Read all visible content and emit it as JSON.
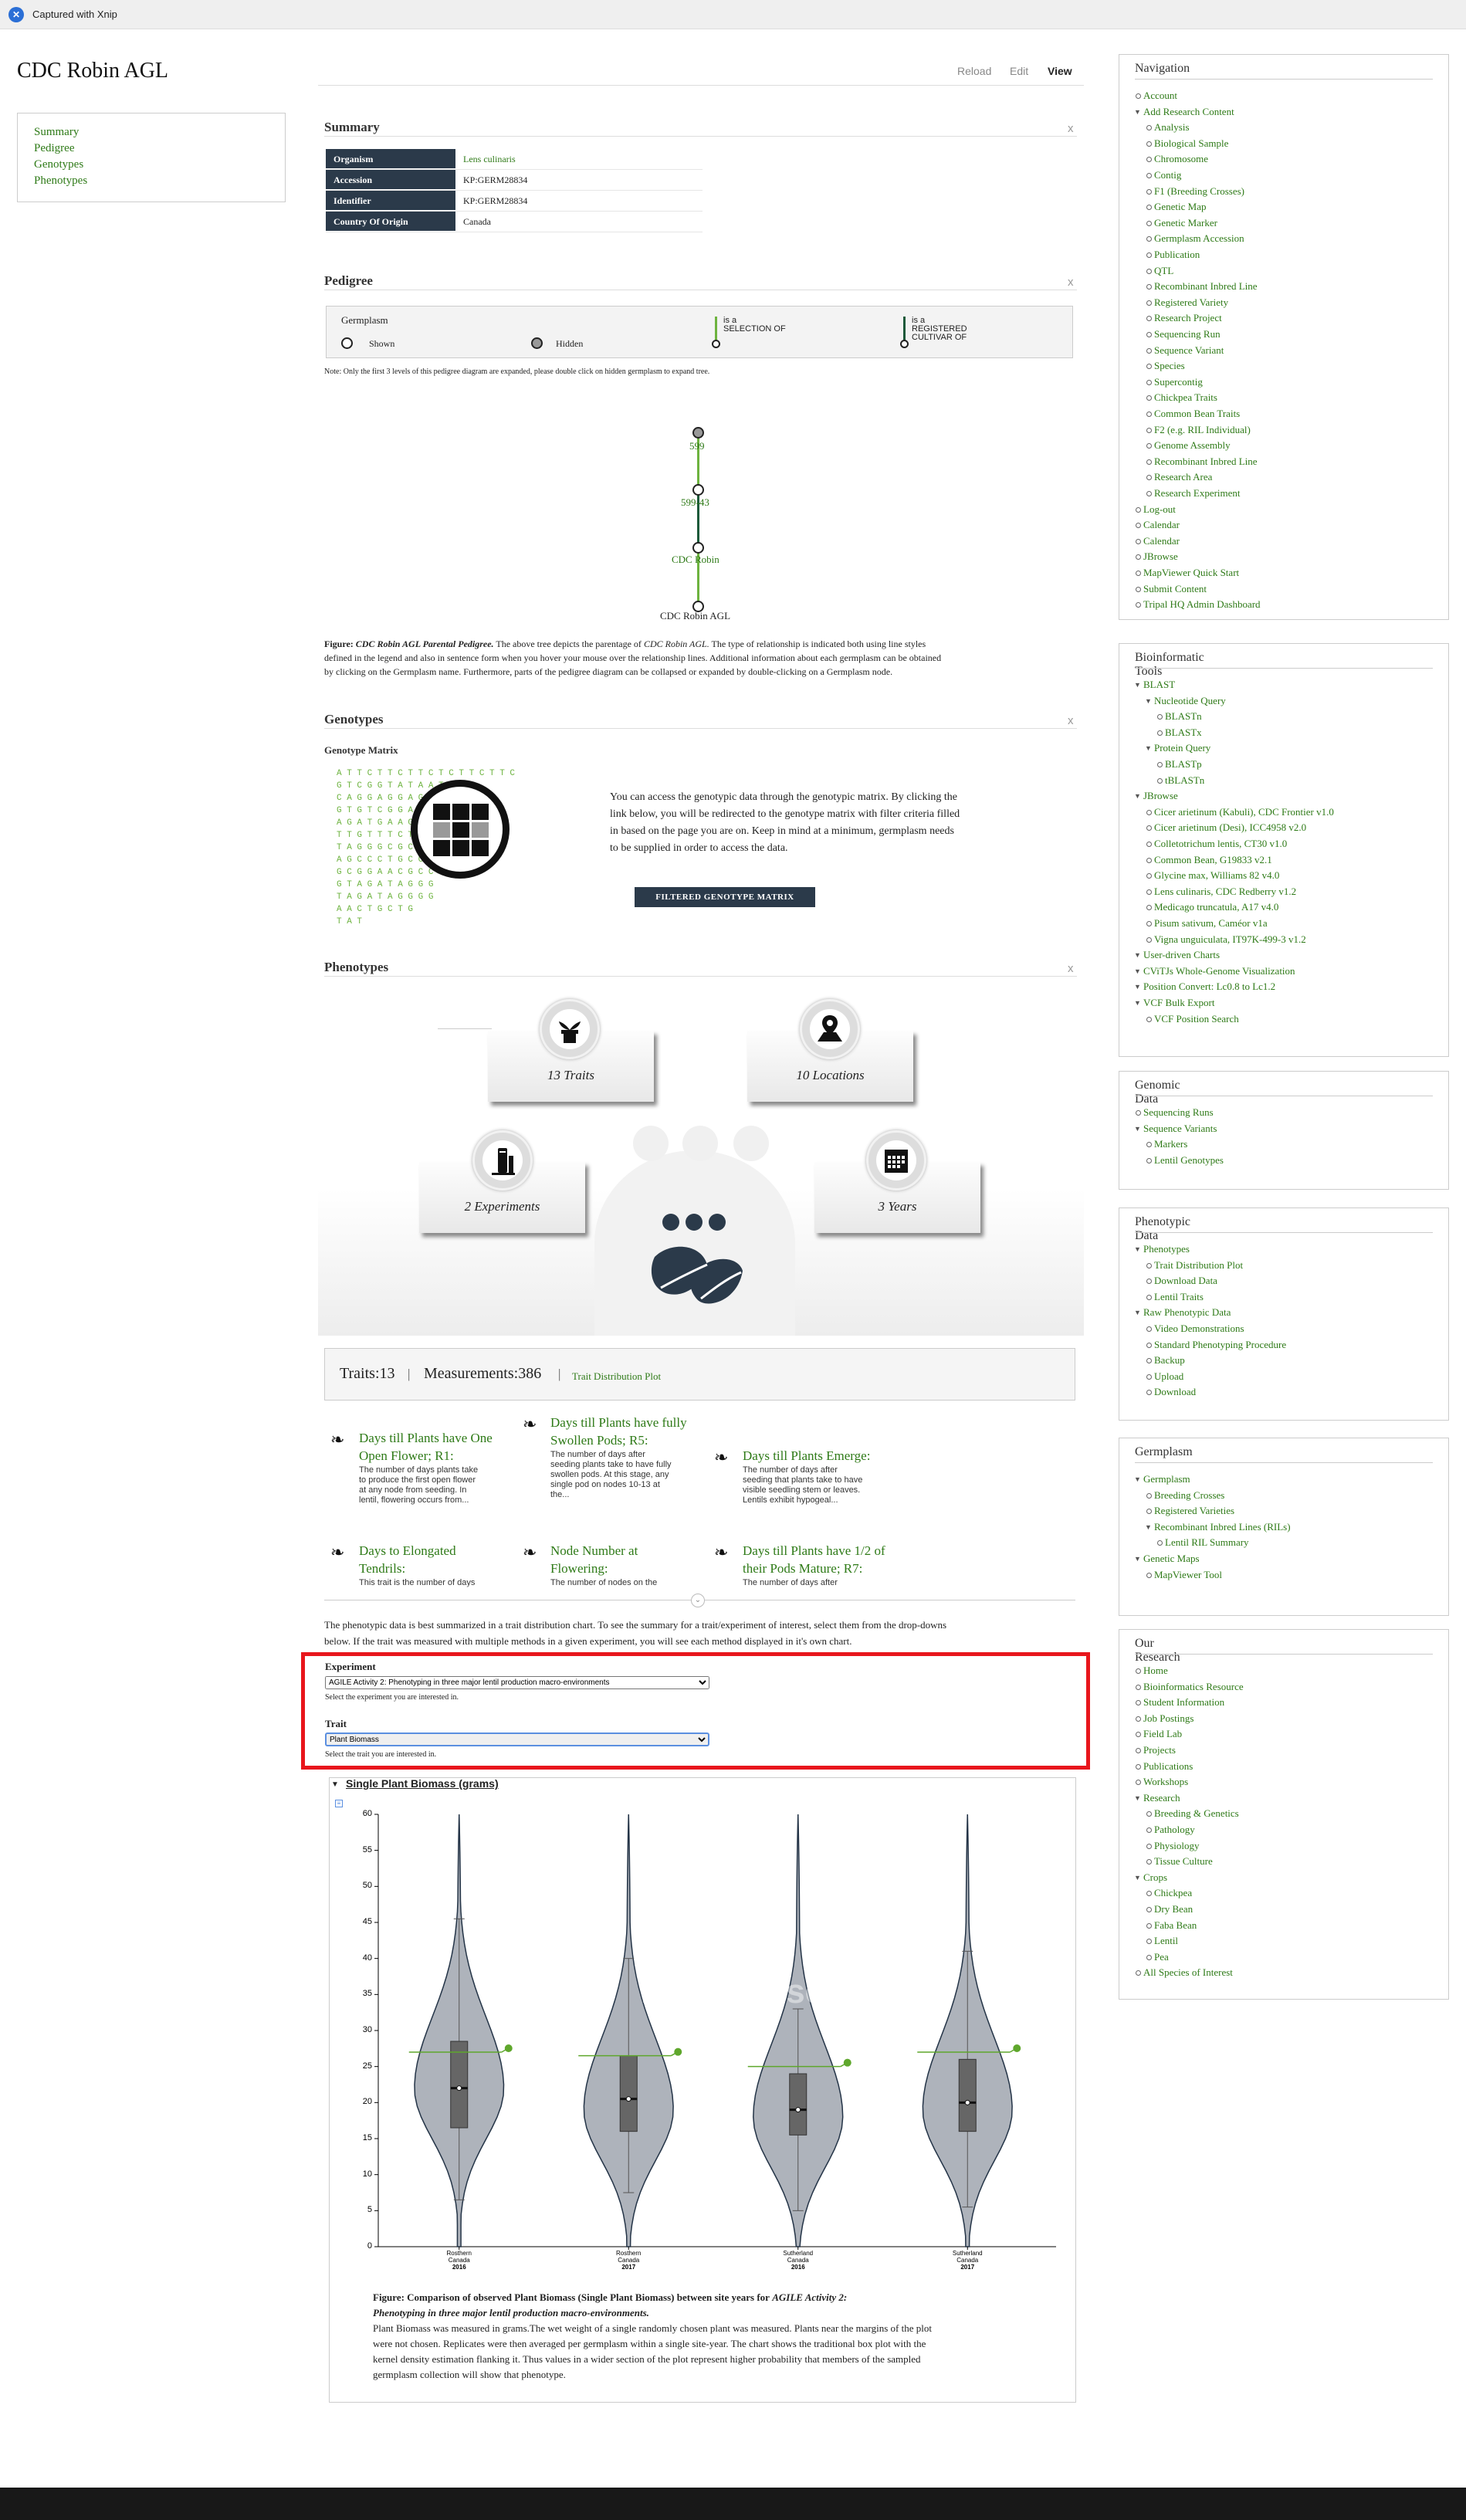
{
  "xnip": {
    "text": "Captured with Xnip"
  },
  "page": {
    "title": "CDC Robin AGL",
    "tabs": [
      "Reload",
      "Edit",
      "View"
    ]
  },
  "left_nav": [
    "Summary",
    "Pedigree",
    "Genotypes",
    "Phenotypes"
  ],
  "summary": {
    "heading": "Summary",
    "close": "x",
    "rows": [
      {
        "label": "Organism",
        "value": "Lens culinaris"
      },
      {
        "label": "Accession",
        "value": "KP:GERM28834"
      },
      {
        "label": "Identifier",
        "value": "KP:GERM28834"
      },
      {
        "label": "Country Of Origin",
        "value": "Canada"
      }
    ]
  },
  "pedigree": {
    "heading": "Pedigree",
    "close": "x",
    "legend": {
      "title": "Germplasm",
      "shown": "Shown",
      "hidden": "Hidden",
      "sel1": "is a",
      "sel2": "SELECTION OF",
      "reg1": "is a",
      "reg2": "REGISTERED",
      "reg3": "CULTIVAR OF"
    },
    "note": "Note: Only the first 3 levels of this pedigree diagram are expanded, please double click on hidden germplasm to expand tree.",
    "nodes": [
      "599",
      "599-43",
      "CDC Robin",
      "CDC Robin AGL"
    ],
    "fig_label": "Figure:",
    "fig_bold": "CDC Robin AGL Parental Pedigree.",
    "fig_text1": "The above tree depicts the parentage of",
    "fig_em": "CDC Robin AGL.",
    "fig_text2": "The type of relationship is indicated both using line styles",
    "fig_line2": "defined in the legend and also in sentence form when you hover your mouse over the relationship lines. Additional information about each germplasm can be obtained",
    "fig_line3": "by clicking on the Germplasm name. Furthermore, parts of the pedigree diagram can be collapsed or expanded by double-clicking on a Germplasm node."
  },
  "genotypes": {
    "heading": "Genotypes",
    "close": "x",
    "matrix_title": "Genotype Matrix",
    "dna_rows": [
      "A T T C T T C T T C T C T T C T T C",
      "G T C G G T A T A A T A",
      "C A G G A G G A G G A G",
      "G T G T C G G A G A T G",
      "A G A T G A A G T G G A",
      "T T G T T T C T T G T T",
      "T A G G G C G C C A",
      "A G C C C T G C C C",
      "G C G G A A C G C C",
      "G T A G A T A G G G",
      "T A G A T A G G G G",
      "A A C T G C T G",
      "T A T"
    ],
    "text": [
      "You can access the genotypic data through the genotypic matrix. By clicking the",
      "link below, you will be redirected to the genotype matrix with filter criteria filled",
      "in based on the page you are on. Keep in mind at a minimum, germplasm needs",
      "to be supplied in order to access the data."
    ],
    "button": "FILTERED GENOTYPE MATRIX"
  },
  "phenotypes": {
    "heading": "Phenotypes",
    "close": "x",
    "cards": [
      "13 Traits",
      "10 Locations",
      "2 Experiments",
      "3 Years"
    ],
    "bar": {
      "traits": "Traits:13",
      "sep": "|",
      "measurements": "Measurements:386",
      "link": "Trait Distribution Plot"
    },
    "traits": [
      {
        "title": [
          "Days till Plants have One",
          "Open Flower; R1:"
        ],
        "desc": [
          "The number of days plants take",
          "to produce the first open flower",
          "at any node from seeding. In",
          "lentil, flowering occurs from..."
        ]
      },
      {
        "title": [
          "Days till Plants have fully",
          "Swollen Pods; R5:"
        ],
        "desc": [
          "The number of days after",
          "seeding plants take to have fully",
          "swollen pods. At this stage, any",
          "single pod on nodes 10-13 at",
          "the..."
        ]
      },
      {
        "title": [
          "Days till Plants Emerge:"
        ],
        "desc": [
          "The number of days after",
          "seeding that plants take to have",
          "visible seedling stem or leaves.",
          "Lentils exhibit hypogeal..."
        ]
      },
      {
        "title": [
          "Days to Elongated",
          "Tendrils:"
        ],
        "desc": [
          "This trait is the number of days"
        ]
      },
      {
        "title": [
          "Node Number at",
          "Flowering:"
        ],
        "desc": [
          "The number of nodes on the"
        ]
      },
      {
        "title": [
          "Days till Plants have 1/2 of",
          "their Pods Mature; R7:"
        ],
        "desc": [
          "The number of days after"
        ]
      }
    ],
    "summary_text": [
      "The phenotypic data is best summarized in a trait distribution chart. To see the summary for a trait/experiment of interest, select them from the drop-downs",
      "below. If the trait was measured with multiple methods in a given experiment, you will see each method displayed in it's own chart."
    ],
    "form": {
      "exp_label": "Experiment",
      "exp_value": "AGILE Activity 2: Phenotyping in three major lentil production macro-environments",
      "exp_help": "Select the experiment you are interested in.",
      "trait_label": "Trait",
      "trait_value": "Plant Biomass",
      "trait_help": "Select the trait you are interested in."
    },
    "chart_title": "Single Plant Biomass (grams)",
    "watermark": "KnowPulse",
    "caption": {
      "lead": "Figure: Comparison of observed Plant Biomass (Single Plant Biomass) between site years for",
      "lead_em": "AGILE Activity 2:",
      "line2_em": "Phenotyping in three major lentil production macro-environments.",
      "body": [
        "Plant Biomass was measured in grams.The wet weight of a single randomly chosen plant was measured. Plants near the margins of the plot",
        "were not chosen. Replicates were then averaged per germplasm within a single site-year. The chart shows the traditional box plot with the",
        "kernel density estimation flanking it. Thus values in a wider section of the plot represent higher probability that members of the sampled",
        "germplasm collection will show that phenotype."
      ]
    }
  },
  "chart_data": {
    "type": "violin",
    "ylim": [
      0,
      60
    ],
    "yticks": [
      0,
      5,
      10,
      15,
      20,
      25,
      30,
      35,
      40,
      45,
      50,
      55,
      60
    ],
    "categories": [
      {
        "site": "Rosthern",
        "country": "Canada",
        "year": "2016"
      },
      {
        "site": "Rosthern",
        "country": "Canada",
        "year": "2017"
      },
      {
        "site": "Sutherland",
        "country": "Canada",
        "year": "2016"
      },
      {
        "site": "Sutherland",
        "country": "Canada",
        "year": "2017"
      }
    ],
    "series": [
      {
        "max": 60,
        "q1": 16.5,
        "median": 22,
        "q3": 28.5,
        "whisker_low": 6.5,
        "whisker_high": 45.5,
        "min": 0,
        "mode": 22,
        "highlight": 27
      },
      {
        "max": 60,
        "q1": 16,
        "median": 20.5,
        "q3": 26.5,
        "whisker_low": 7.5,
        "whisker_high": 40,
        "min": 0,
        "mode": 19,
        "highlight": 26.5
      },
      {
        "max": 60,
        "q1": 15.5,
        "median": 19,
        "q3": 24,
        "whisker_low": 5,
        "whisker_high": 33,
        "min": 0,
        "mode": 18,
        "highlight": 25
      },
      {
        "max": 60,
        "q1": 16,
        "median": 20,
        "q3": 26,
        "whisker_low": 5.5,
        "whisker_high": 41,
        "min": 0,
        "mode": 19,
        "highlight": 27
      }
    ]
  },
  "sidebar": {
    "navigation": {
      "heading": "Navigation",
      "items": [
        {
          "t": "Account",
          "l": 0,
          "m": "b"
        },
        {
          "t": "Add Research Content",
          "l": 0,
          "m": "t"
        },
        {
          "t": "Analysis",
          "l": 1,
          "m": "b"
        },
        {
          "t": "Biological Sample",
          "l": 1,
          "m": "b"
        },
        {
          "t": "Chromosome",
          "l": 1,
          "m": "b"
        },
        {
          "t": "Contig",
          "l": 1,
          "m": "b"
        },
        {
          "t": "F1 (Breeding Crosses)",
          "l": 1,
          "m": "b"
        },
        {
          "t": "Genetic Map",
          "l": 1,
          "m": "b"
        },
        {
          "t": "Genetic Marker",
          "l": 1,
          "m": "b"
        },
        {
          "t": "Germplasm Accession",
          "l": 1,
          "m": "b"
        },
        {
          "t": "Publication",
          "l": 1,
          "m": "b"
        },
        {
          "t": "QTL",
          "l": 1,
          "m": "b"
        },
        {
          "t": "Recombinant Inbred Line",
          "l": 1,
          "m": "b"
        },
        {
          "t": "Registered Variety",
          "l": 1,
          "m": "b"
        },
        {
          "t": "Research Project",
          "l": 1,
          "m": "b"
        },
        {
          "t": "Sequencing Run",
          "l": 1,
          "m": "b"
        },
        {
          "t": "Sequence Variant",
          "l": 1,
          "m": "b"
        },
        {
          "t": "Species",
          "l": 1,
          "m": "b"
        },
        {
          "t": "Supercontig",
          "l": 1,
          "m": "b"
        },
        {
          "t": "Chickpea Traits",
          "l": 1,
          "m": "b"
        },
        {
          "t": "Common Bean Traits",
          "l": 1,
          "m": "b"
        },
        {
          "t": "F2 (e.g. RIL Individual)",
          "l": 1,
          "m": "b"
        },
        {
          "t": "Genome Assembly",
          "l": 1,
          "m": "b"
        },
        {
          "t": "Recombinant Inbred Line",
          "l": 1,
          "m": "b"
        },
        {
          "t": "Research Area",
          "l": 1,
          "m": "b"
        },
        {
          "t": "Research Experiment",
          "l": 1,
          "m": "b"
        },
        {
          "t": "Log-out",
          "l": 0,
          "m": "b"
        },
        {
          "t": "Calendar",
          "l": 0,
          "m": "b"
        },
        {
          "t": "Calendar",
          "l": 0,
          "m": "b"
        },
        {
          "t": "JBrowse",
          "l": 0,
          "m": "b"
        },
        {
          "t": "MapViewer Quick Start",
          "l": 0,
          "m": "b"
        },
        {
          "t": "Submit Content",
          "l": 0,
          "m": "b"
        },
        {
          "t": "Tripal HQ Admin Dashboard",
          "l": 0,
          "m": "b"
        }
      ]
    },
    "bioinformatic": {
      "heading": "Bioinformatic Tools",
      "items": [
        {
          "t": "BLAST",
          "l": 0,
          "m": "t"
        },
        {
          "t": "Nucleotide Query",
          "l": 1,
          "m": "t"
        },
        {
          "t": "BLASTn",
          "l": 2,
          "m": "b"
        },
        {
          "t": "BLASTx",
          "l": 2,
          "m": "b"
        },
        {
          "t": "Protein Query",
          "l": 1,
          "m": "t"
        },
        {
          "t": "BLASTp",
          "l": 2,
          "m": "b"
        },
        {
          "t": "tBLASTn",
          "l": 2,
          "m": "b"
        },
        {
          "t": "JBrowse",
          "l": 0,
          "m": "t"
        },
        {
          "t": "Cicer arietinum (Kabuli), CDC Frontier v1.0",
          "l": 1,
          "m": "b"
        },
        {
          "t": "Cicer arietinum (Desi), ICC4958 v2.0",
          "l": 1,
          "m": "b"
        },
        {
          "t": "Colletotrichum lentis, CT30 v1.0",
          "l": 1,
          "m": "b"
        },
        {
          "t": "Common Bean, G19833 v2.1",
          "l": 1,
          "m": "b"
        },
        {
          "t": "Glycine max, Williams 82 v4.0",
          "l": 1,
          "m": "b"
        },
        {
          "t": "Lens culinaris, CDC Redberry v1.2",
          "l": 1,
          "m": "b"
        },
        {
          "t": "Medicago truncatula, A17 v4.0",
          "l": 1,
          "m": "b"
        },
        {
          "t": "Pisum sativum, Caméor v1a",
          "l": 1,
          "m": "b"
        },
        {
          "t": "Vigna unguiculata, IT97K-499-3 v1.2",
          "l": 1,
          "m": "b"
        },
        {
          "t": "User-driven Charts",
          "l": 0,
          "m": "t"
        },
        {
          "t": "CViTJs Whole-Genome Visualization",
          "l": 0,
          "m": "t"
        },
        {
          "t": "Position Convert: Lc0.8 to Lc1.2",
          "l": 0,
          "m": "t"
        },
        {
          "t": "VCF Bulk Export",
          "l": 0,
          "m": "t"
        },
        {
          "t": "VCF Position Search",
          "l": 1,
          "m": "b"
        }
      ]
    },
    "genomic": {
      "heading": "Genomic Data",
      "items": [
        {
          "t": "Sequencing Runs",
          "l": 0,
          "m": "b"
        },
        {
          "t": "Sequence Variants",
          "l": 0,
          "m": "t"
        },
        {
          "t": "Markers",
          "l": 1,
          "m": "b"
        },
        {
          "t": "Lentil Genotypes",
          "l": 1,
          "m": "b"
        }
      ]
    },
    "phenotypic": {
      "heading": "Phenotypic Data",
      "items": [
        {
          "t": "Phenotypes",
          "l": 0,
          "m": "t"
        },
        {
          "t": "Trait Distribution Plot",
          "l": 1,
          "m": "b"
        },
        {
          "t": "Download Data",
          "l": 1,
          "m": "b"
        },
        {
          "t": "Lentil Traits",
          "l": 1,
          "m": "b"
        },
        {
          "t": "Raw Phenotypic Data",
          "l": 0,
          "m": "t"
        },
        {
          "t": "Video Demonstrations",
          "l": 1,
          "m": "b"
        },
        {
          "t": "Standard Phenotyping Procedure",
          "l": 1,
          "m": "b"
        },
        {
          "t": "Backup",
          "l": 1,
          "m": "b"
        },
        {
          "t": "Upload",
          "l": 1,
          "m": "b"
        },
        {
          "t": "Download",
          "l": 1,
          "m": "b"
        }
      ]
    },
    "germplasm": {
      "heading": "Germplasm",
      "items": [
        {
          "t": "Germplasm",
          "l": 0,
          "m": "t"
        },
        {
          "t": "Breeding Crosses",
          "l": 1,
          "m": "b"
        },
        {
          "t": "Registered Varieties",
          "l": 1,
          "m": "b"
        },
        {
          "t": "Recombinant Inbred Lines (RILs)",
          "l": 1,
          "m": "t"
        },
        {
          "t": "Lentil RIL Summary",
          "l": 2,
          "m": "b"
        },
        {
          "t": "Genetic Maps",
          "l": 0,
          "m": "t"
        },
        {
          "t": "MapViewer Tool",
          "l": 1,
          "m": "b"
        }
      ]
    },
    "research": {
      "heading": "Our Research",
      "items": [
        {
          "t": "Home",
          "l": 0,
          "m": "b"
        },
        {
          "t": "Bioinformatics Resource",
          "l": 0,
          "m": "b"
        },
        {
          "t": "Student Information",
          "l": 0,
          "m": "b"
        },
        {
          "t": "Job Postings",
          "l": 0,
          "m": "b"
        },
        {
          "t": "Field Lab",
          "l": 0,
          "m": "b"
        },
        {
          "t": "Projects",
          "l": 0,
          "m": "b"
        },
        {
          "t": "Publications",
          "l": 0,
          "m": "b"
        },
        {
          "t": "Workshops",
          "l": 0,
          "m": "b"
        },
        {
          "t": "Research",
          "l": 0,
          "m": "t"
        },
        {
          "t": "Breeding & Genetics",
          "l": 1,
          "m": "b"
        },
        {
          "t": "Pathology",
          "l": 1,
          "m": "b"
        },
        {
          "t": "Physiology",
          "l": 1,
          "m": "b"
        },
        {
          "t": "Tissue Culture",
          "l": 1,
          "m": "b"
        },
        {
          "t": "Crops",
          "l": 0,
          "m": "t"
        },
        {
          "t": "Chickpea",
          "l": 1,
          "m": "b"
        },
        {
          "t": "Dry Bean",
          "l": 1,
          "m": "b"
        },
        {
          "t": "Faba Bean",
          "l": 1,
          "m": "b"
        },
        {
          "t": "Lentil",
          "l": 1,
          "m": "b"
        },
        {
          "t": "Pea",
          "l": 1,
          "m": "b"
        },
        {
          "t": "All Species of Interest",
          "l": 0,
          "m": "b"
        }
      ]
    }
  },
  "colors": {
    "link": "#2e7a17",
    "highlight_box": "#e8161c",
    "dark": "#2b3a4a",
    "violin": "#aeb3bb",
    "accent_green": "#5fa72c"
  }
}
